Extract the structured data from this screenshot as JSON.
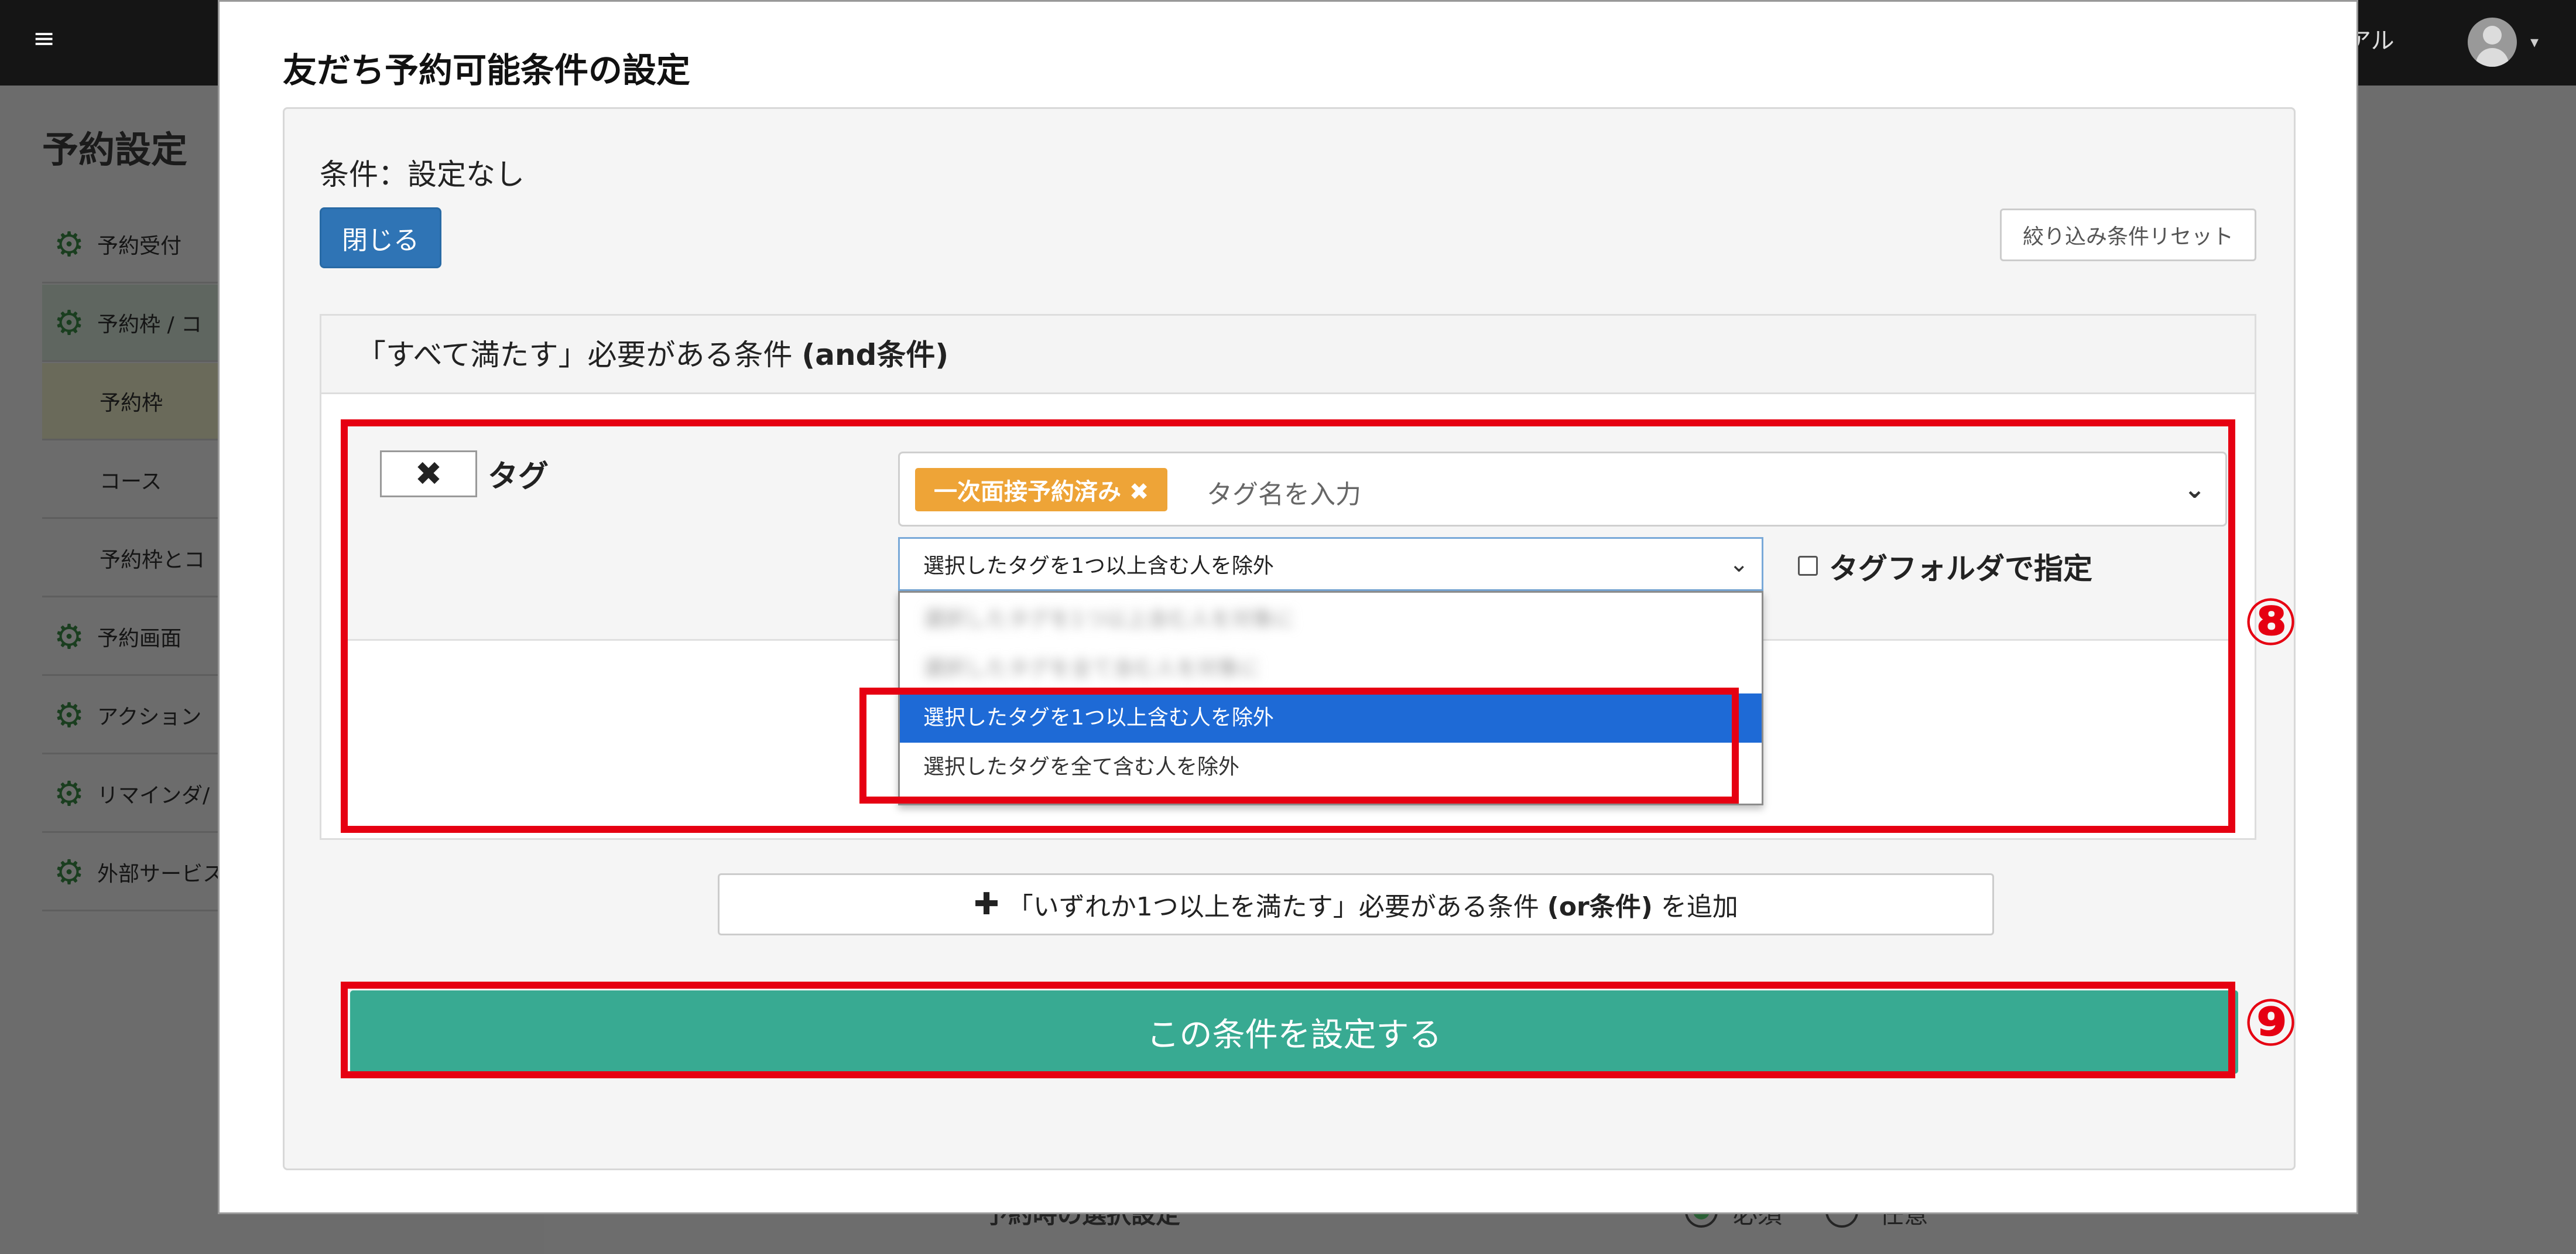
{
  "topbar": {
    "menu_icon": "≡",
    "right_text": "アル",
    "avatar_caret": "▾"
  },
  "sidebar": {
    "title": "予約設定",
    "items": [
      {
        "label": "予約受付",
        "icon": "gear-icon"
      },
      {
        "label": "予約枠 / コ",
        "icon": "gear-icon"
      },
      {
        "label": "予約枠"
      },
      {
        "label": "コース"
      },
      {
        "label": "予約枠とコ"
      },
      {
        "label": "予約画面",
        "icon": "gear-icon"
      },
      {
        "label": "アクション",
        "icon": "gear-icon"
      },
      {
        "label": "リマインダ/",
        "icon": "gear-icon"
      },
      {
        "label": "外部サービス",
        "icon": "gear-icon"
      }
    ]
  },
  "background": {
    "bottom_label": "予約時の選択設定",
    "radio_required": "必須",
    "radio_optional": "任意"
  },
  "modal": {
    "title": "友だち予約可能条件の設定",
    "condition_text": "条件：設定なし",
    "close_button": "閉じる",
    "reset_button": "絞り込み条件リセット",
    "and_header_prefix": "「すべて満たす」必要がある条件 ",
    "and_header_bold": "(and条件)",
    "remove_button_icon": "✖",
    "tag_label": "タグ",
    "tag_chip": "一次面接予約済み ✖",
    "tag_placeholder": "タグ名を入力",
    "tag_chevron": "⌄",
    "select_value": "選択したタグを1つ以上含む人を除外",
    "select_arrow": "⌄",
    "folder_label": "タグフォルダで指定",
    "dropdown_options": [
      "選択したタグを1つ以上含む人を対象に",
      "選択したタグを全て含む人を対象に",
      "選択したタグを1つ以上含む人を除外",
      "選択したタグを全て含む人を除外"
    ],
    "or_add_icon": "✚",
    "or_add_prefix": "「いずれか1つ以上を満たす」必要がある条件",
    "or_add_bold": "(or条件)",
    "or_add_suffix": "を追加",
    "apply_button": "この条件を設定する"
  },
  "callouts": {
    "eight": "⑧",
    "nine": "⑨",
    "color": "#e60012"
  },
  "colors": {
    "primary_button": "#2f74b5",
    "tag_chip": "#eea437",
    "apply_button": "#38aa92",
    "selected_option": "#1e6ad6"
  }
}
